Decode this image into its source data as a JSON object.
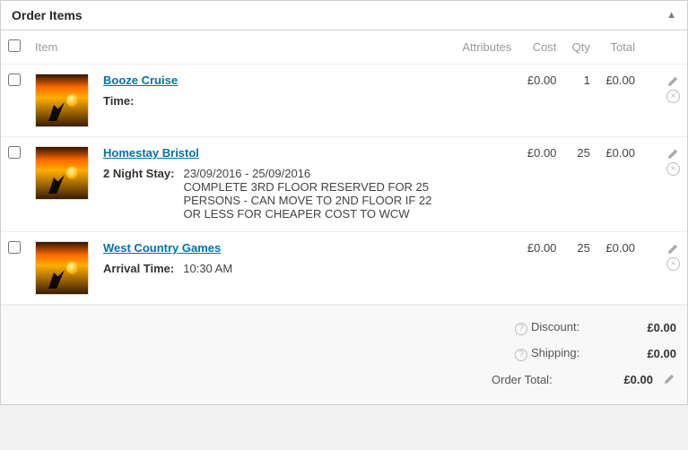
{
  "panel": {
    "title": "Order Items"
  },
  "columns": {
    "item": "Item",
    "attributes": "Attributes",
    "cost": "Cost",
    "qty": "Qty",
    "total": "Total"
  },
  "items": [
    {
      "name": "Booze Cruise",
      "cost": "£0.00",
      "qty": "1",
      "total": "£0.00",
      "meta": [
        {
          "label": "Time:",
          "value": ""
        }
      ]
    },
    {
      "name": "Homestay Bristol",
      "cost": "£0.00",
      "qty": "25",
      "total": "£0.00",
      "meta": [
        {
          "label": "2 Night Stay:",
          "value": "23/09/2016 - 25/09/2016\nCOMPLETE 3RD FLOOR RESERVED FOR 25 PERSONS - CAN MOVE TO 2ND FLOOR IF 22 OR LESS FOR CHEAPER COST TO WCW"
        }
      ]
    },
    {
      "name": "West Country Games",
      "cost": "£0.00",
      "qty": "25",
      "total": "£0.00",
      "meta": [
        {
          "label": "Arrival Time:",
          "value": "10:30 AM"
        }
      ]
    }
  ],
  "totals": {
    "discount_label": "Discount:",
    "discount_value": "£0.00",
    "shipping_label": "Shipping:",
    "shipping_value": "£0.00",
    "order_total_label": "Order Total:",
    "order_total_value": "£0.00"
  }
}
